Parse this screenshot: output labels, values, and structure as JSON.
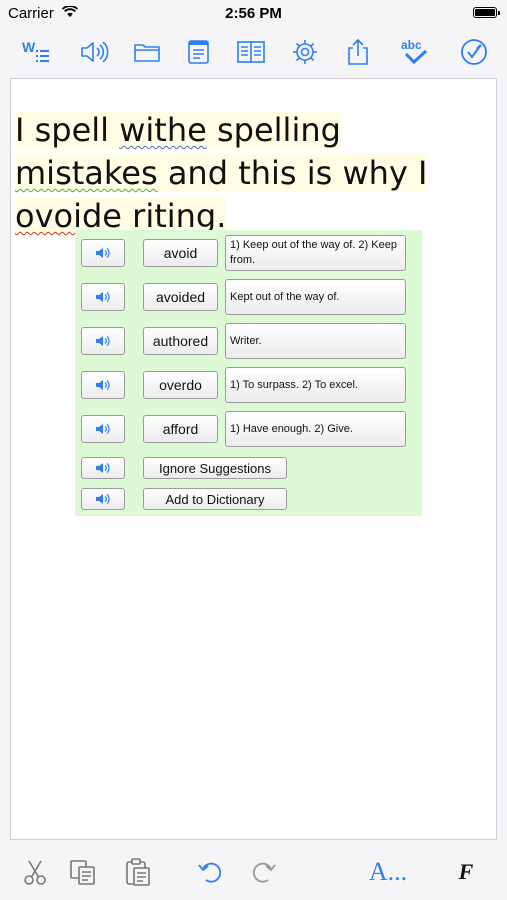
{
  "status": {
    "carrier": "Carrier",
    "time": "2:56 PM"
  },
  "toolbar": {
    "accent": "#2f7ff0",
    "items": [
      "word-list-icon",
      "speaker-icon",
      "folder-icon",
      "document-icon",
      "book-icon",
      "gear-icon",
      "share-icon",
      "spellcheck-abc-icon",
      "proofread-check-icon"
    ],
    "abc_label": "abc"
  },
  "document": {
    "line1_prefix": "I spell ",
    "line1_err": "withe",
    "line1_suffix": " spelling",
    "line2_err": "mistakes",
    "line2_suffix": " and this is why I",
    "line3_err": "ovoide",
    "line3_mid": " ",
    "line3_err2": "riting",
    "line3_suffix": "."
  },
  "suggestions": {
    "items": [
      {
        "word": "avoid",
        "definition": "1) Keep out of the way of. 2) Keep from."
      },
      {
        "word": "avoided",
        "definition": "Kept out of the way of."
      },
      {
        "word": "authored",
        "definition": "Writer."
      },
      {
        "word": "overdo",
        "definition": "1) To surpass. 2) To excel."
      },
      {
        "word": "afford",
        "definition": "1) Have enough. 2) Give."
      }
    ],
    "ignore_label": "Ignore Suggestions",
    "add_label": "Add to Dictionary"
  },
  "bottombar": {
    "items": [
      "cut-icon",
      "copy-icon",
      "paste-icon",
      "undo-icon",
      "redo-icon",
      "font-size-icon",
      "font-style-icon"
    ],
    "font_label": "A...",
    "style_label": "F"
  }
}
